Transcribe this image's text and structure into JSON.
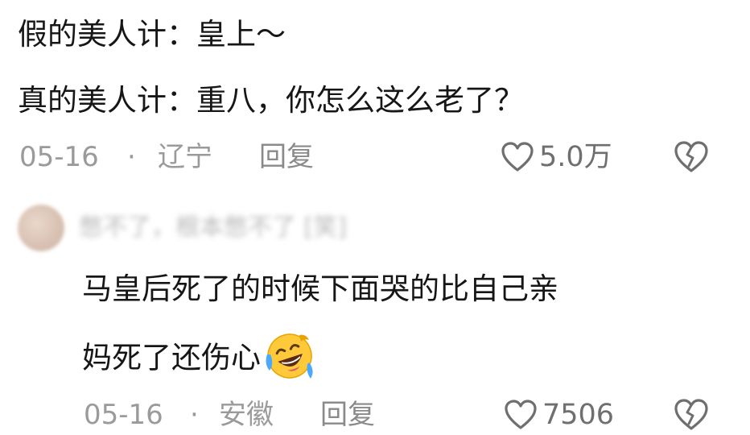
{
  "comment": {
    "line_1": "假的美人计：皇上～",
    "line_2": "真的美人计：重八，你怎么这么老了？",
    "date": "05-16",
    "location": "辽宁",
    "reply_label": "回复",
    "like_count": "5.0万"
  },
  "reply": {
    "username": "憋不了，根本憋不了 [笑]",
    "line_1": "马皇后死了的时候下面哭的比自己亲",
    "line_2": "妈死了还伤心",
    "date": "05-16",
    "location": "安徽",
    "reply_label": "回复",
    "like_count": "7506"
  },
  "separator": "·",
  "icons": {
    "like": "heart-outline-icon",
    "dislike": "broken-heart-icon",
    "emoji": "rofl-emoji"
  },
  "colors": {
    "text": "#161616",
    "meta": "#9a9a9a",
    "icon": "#6f6f6f"
  }
}
